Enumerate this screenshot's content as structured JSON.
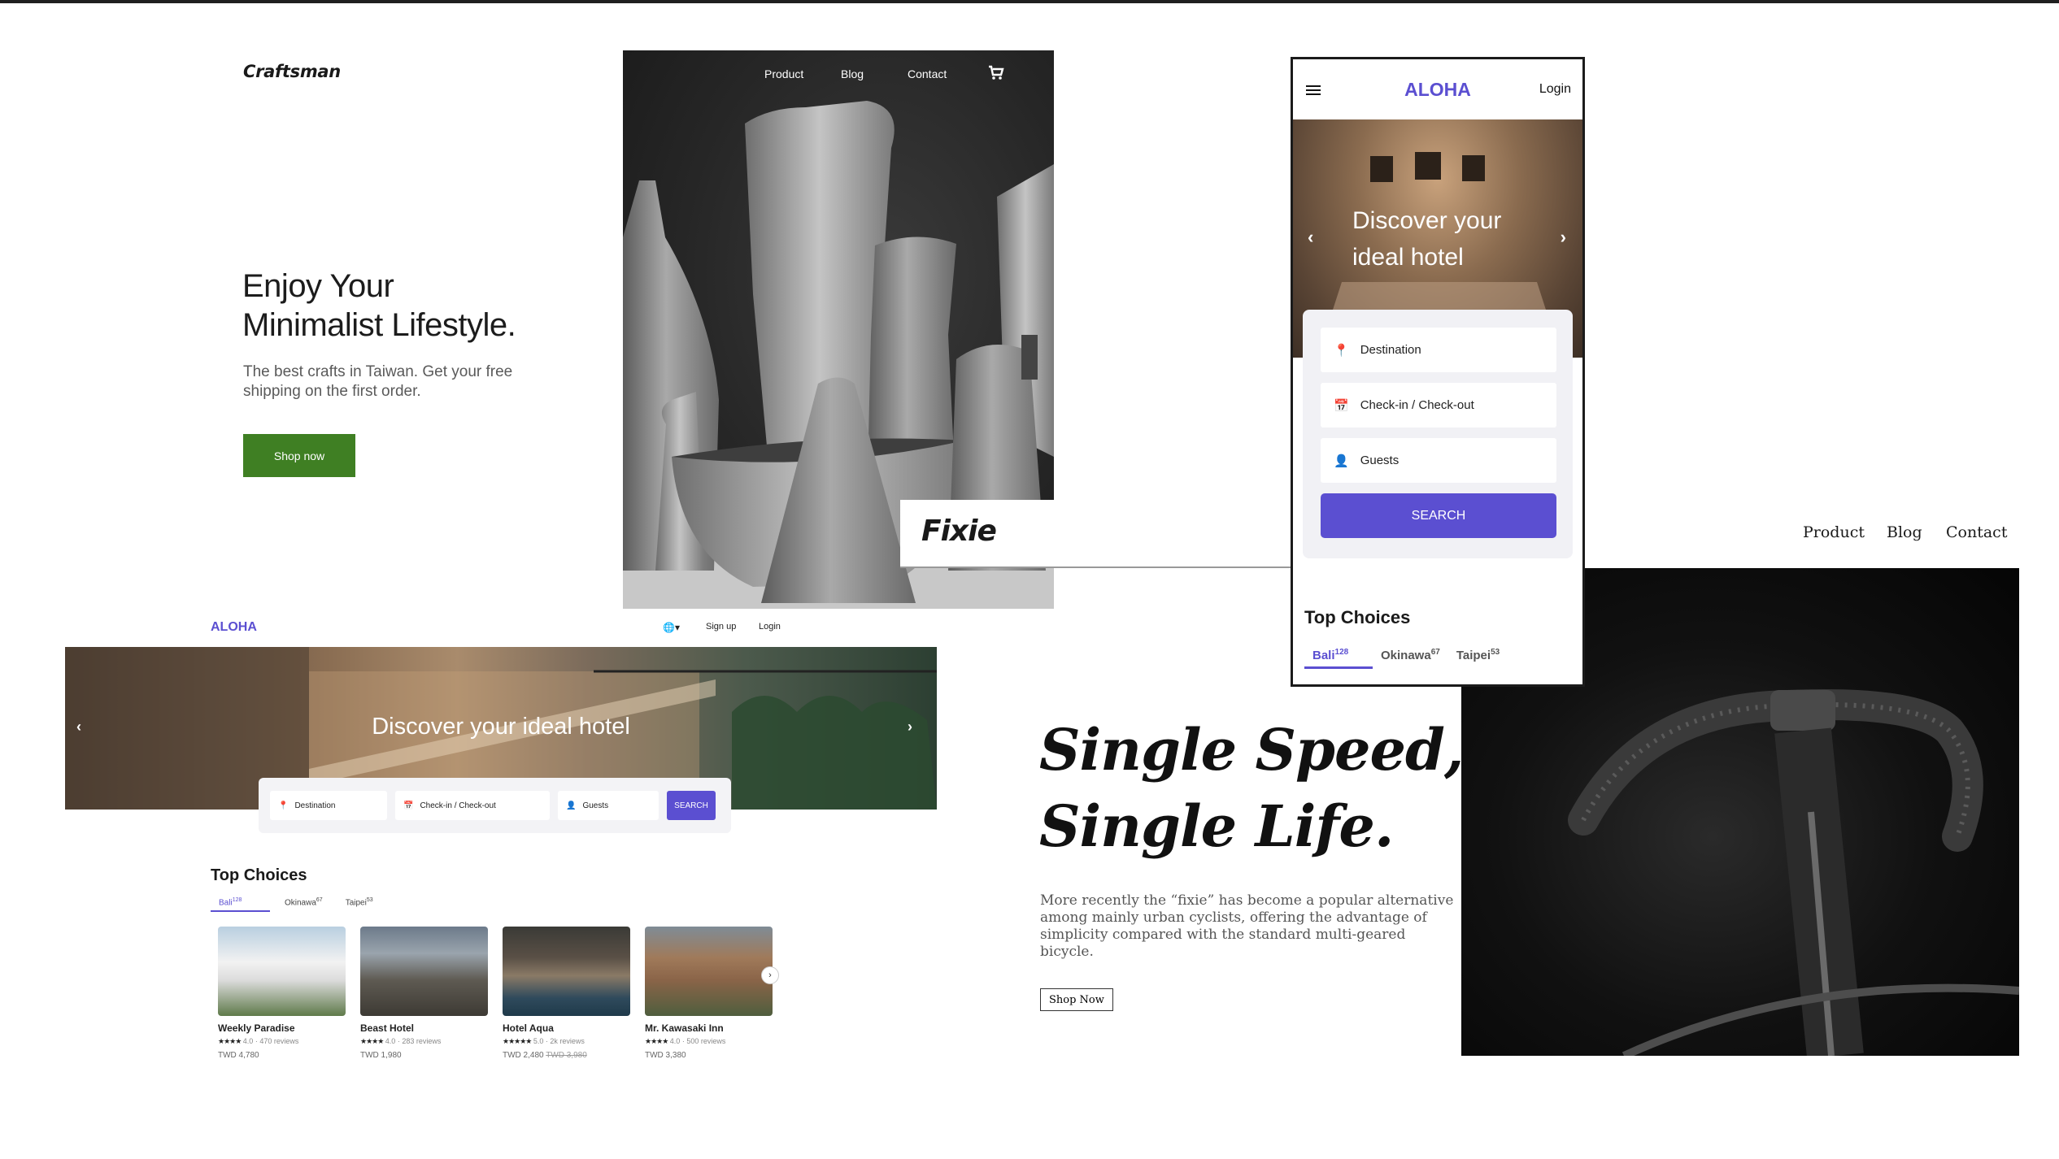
{
  "craftsman": {
    "logo": "Craftsman",
    "nav": [
      "Product",
      "Blog",
      "Contact"
    ],
    "cart_icon": "cart-icon",
    "title_line1": "Enjoy Your",
    "title_line2": "Minimalist Lifestyle.",
    "subtitle": "The best crafts in Taiwan. Get your free shipping on the first order.",
    "cta": "Shop now",
    "accent": "#3f7f23"
  },
  "fixie": {
    "logo": "Fixie",
    "nav": [
      "Product",
      "Blog",
      "Contact"
    ],
    "title_line1": "Single Speed,",
    "title_line2": "Single Life.",
    "body": "More recently the “fixie” has become a popular alternative among mainly urban cyclists, offering the advantage of simplicity compared with the standard multi-geared bicycle.",
    "cta": "Shop Now"
  },
  "aloha_desktop": {
    "logo": "ALOHA",
    "top_links": [
      "Sign up",
      "Login"
    ],
    "hero_title": "Discover your ideal hotel",
    "search": {
      "destination": "Destination",
      "dates": "Check-in / Check-out",
      "guests": "Guests",
      "button": "SEARCH"
    },
    "section_title": "Top Choices",
    "tabs": [
      {
        "label": "Bali",
        "count": "128"
      },
      {
        "label": "Okinawa",
        "count": "67"
      },
      {
        "label": "Taipei",
        "count": "53"
      }
    ],
    "cards": [
      {
        "name": "Weekly Paradise",
        "stars": "★★★★",
        "rating": "4.0",
        "reviews": "470 reviews",
        "price": "TWD 4,780",
        "old_price": ""
      },
      {
        "name": "Beast Hotel",
        "stars": "★★★★",
        "rating": "4.0",
        "reviews": "283 reviews",
        "price": "TWD 1,980",
        "old_price": ""
      },
      {
        "name": "Hotel Aqua",
        "stars": "★★★★★",
        "rating": "5.0",
        "reviews": "2k reviews",
        "price": "TWD 2,480",
        "old_price": "TWD 3,980"
      },
      {
        "name": "Mr. Kawasaki Inn",
        "stars": "★★★★",
        "rating": "4.0",
        "reviews": "500 reviews",
        "price": "TWD 3,380",
        "old_price": ""
      }
    ],
    "accent": "#5b4fd1"
  },
  "aloha_mobile": {
    "logo": "ALOHA",
    "login": "Login",
    "hero_title": "Discover your ideal hotel",
    "search": {
      "destination": "Destination",
      "dates": "Check-in / Check-out",
      "guests": "Guests",
      "button": "SEARCH"
    },
    "section_title": "Top Choices",
    "tabs": [
      {
        "label": "Bali",
        "count": "128"
      },
      {
        "label": "Okinawa",
        "count": "67"
      },
      {
        "label": "Taipei",
        "count": "53"
      }
    ]
  }
}
